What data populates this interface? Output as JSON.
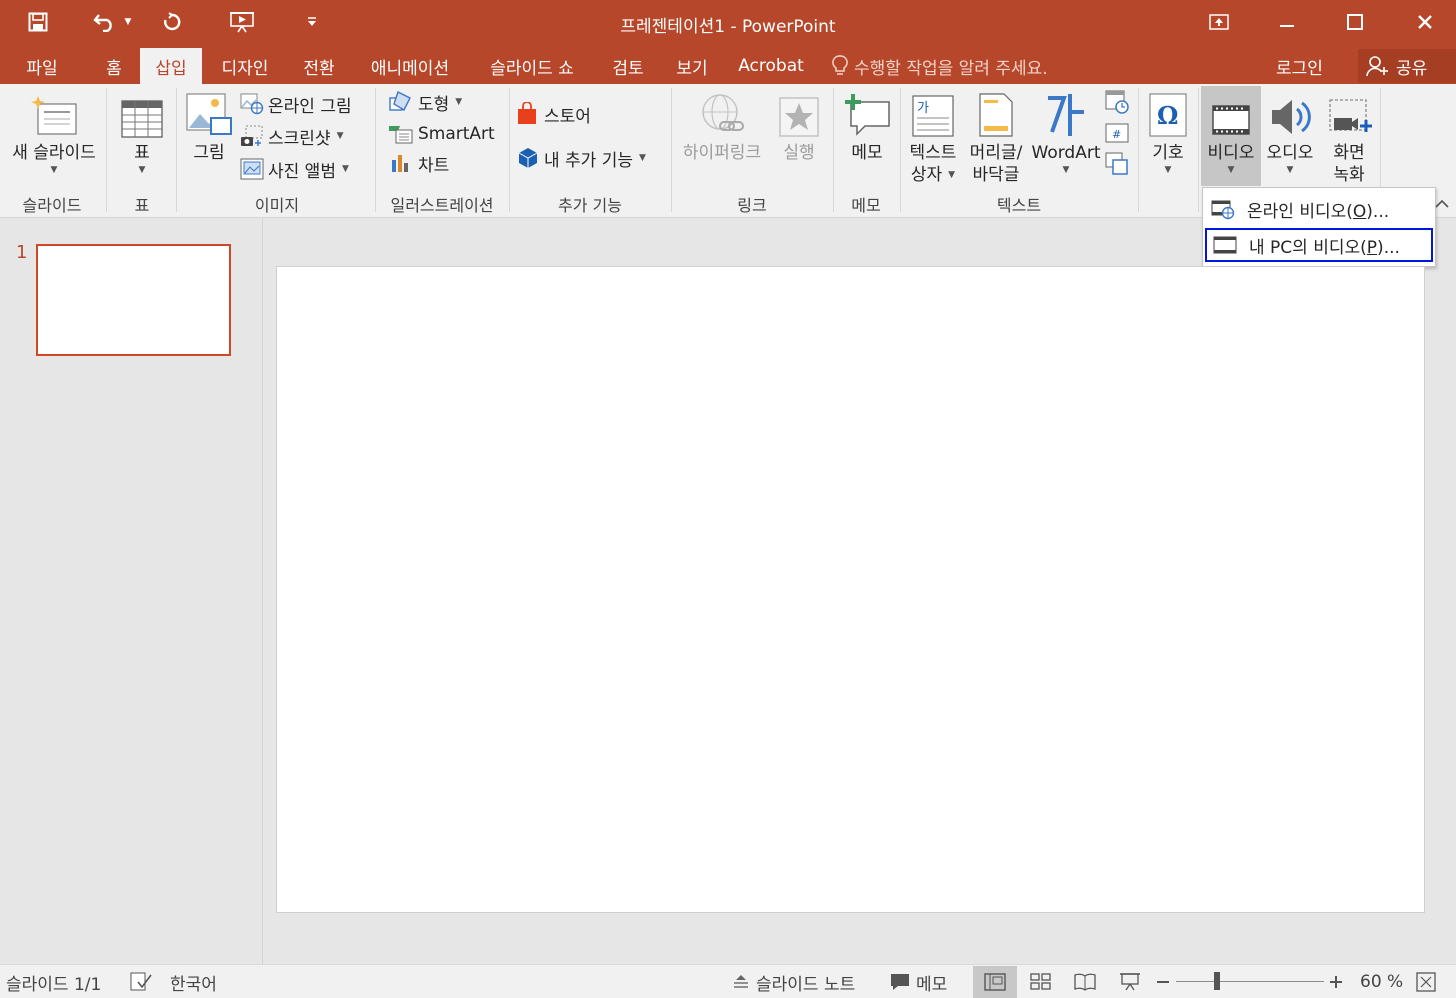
{
  "window": {
    "title": "프레젠테이션1 - PowerPoint"
  },
  "colors": {
    "accent": "#b7472a",
    "selection_outline": "#0016d8"
  },
  "quick_access": [
    {
      "name": "save",
      "icon": "save-icon"
    },
    {
      "name": "undo",
      "icon": "undo-icon"
    },
    {
      "name": "redo",
      "icon": "repeat-icon"
    },
    {
      "name": "start-from-beginning",
      "icon": "presentation-start-icon"
    },
    {
      "name": "customize",
      "icon": "customize-caret-icon"
    }
  ],
  "tabs": [
    {
      "label": "파일",
      "active": false
    },
    {
      "label": "홈",
      "active": false
    },
    {
      "label": "삽입",
      "active": true
    },
    {
      "label": "디자인",
      "active": false
    },
    {
      "label": "전환",
      "active": false
    },
    {
      "label": "애니메이션",
      "active": false
    },
    {
      "label": "슬라이드 쇼",
      "active": false
    },
    {
      "label": "검토",
      "active": false
    },
    {
      "label": "보기",
      "active": false
    },
    {
      "label": "Acrobat",
      "active": false
    }
  ],
  "tell_me": "수행할 작업을 알려 주세요.",
  "account": {
    "login": "로그인",
    "share": "공유"
  },
  "ribbon": {
    "slides": {
      "label": "슬라이드",
      "new_slide": "새 슬라이드"
    },
    "tables": {
      "label": "표",
      "table": "표"
    },
    "images": {
      "label": "이미지",
      "picture": "그림",
      "online_picture": "온라인 그림",
      "screenshot": "스크린샷",
      "photo_album": "사진 앨범"
    },
    "illustrations": {
      "label": "일러스트레이션",
      "shapes": "도형",
      "smartart": "SmartArt",
      "chart": "차트"
    },
    "addins": {
      "label": "추가 기능",
      "store": "스토어",
      "my_addins": "내 추가 기능"
    },
    "links": {
      "label": "링크",
      "hyperlink": "하이퍼링크",
      "action": "실행"
    },
    "comments": {
      "label": "메모",
      "comment": "메모"
    },
    "text": {
      "label": "텍스트",
      "textbox_line1": "텍스트",
      "textbox_line2": "상자",
      "header_line1": "머리글/",
      "header_line2": "바닥글",
      "wordart": "WordArt"
    },
    "symbols": {
      "symbol": "기호"
    },
    "media": {
      "video": "비디오",
      "audio": "오디오",
      "screen_rec_line1": "화면",
      "screen_rec_line2": "녹화"
    }
  },
  "video_menu": {
    "items": [
      {
        "prefix": "온라인 비디오",
        "key": "O",
        "suffix": "...",
        "selected": false
      },
      {
        "prefix": "내 PC의 비디오",
        "key": "P",
        "suffix": "...",
        "selected": true
      }
    ]
  },
  "thumbnails": [
    {
      "number": "1"
    }
  ],
  "status": {
    "slide_info": "슬라이드 1/1",
    "language": "한국어",
    "notes": "슬라이드 노트",
    "comments": "메모",
    "zoom": "60 %",
    "zoom_level": 0.6
  }
}
